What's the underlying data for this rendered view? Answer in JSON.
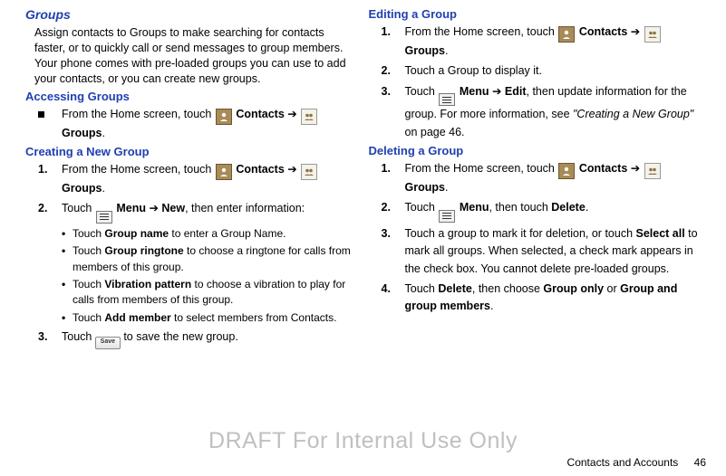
{
  "left": {
    "groups_heading": "Groups",
    "intro": "Assign contacts to Groups to make searching for contacts faster, or to quickly call or send messages to group members. Your phone comes with pre-loaded groups you can use to add your contacts, or you can create new groups.",
    "accessing_heading": "Accessing Groups",
    "accessing_pre": "From the Home screen, touch ",
    "contacts_label": "Contacts",
    "arrow": " ➔ ",
    "groups_label": "Groups",
    "period": ".",
    "creating_heading": "Creating a New Group",
    "c1_pre": "From the Home screen, touch ",
    "c2_pre": "Touch ",
    "c2_label_menu": "Menu",
    "c2_new": "New",
    "c2_post": ", then enter information:",
    "c2s1_pre": "Touch ",
    "c2s1_b": "Group name",
    "c2s1_post": " to enter a Group Name.",
    "c2s2_pre": "Touch ",
    "c2s2_b": "Group ringtone",
    "c2s2_post": " to choose a ringtone for calls from members of this group.",
    "c2s3_pre": "Touch ",
    "c2s3_b": "Vibration pattern",
    "c2s3_post": " to choose a vibration to play for calls from members of this group.",
    "c2s4_pre": "Touch ",
    "c2s4_b": "Add member",
    "c2s4_post": " to select members from Contacts.",
    "c3_pre": "Touch ",
    "c3_post": " to save the new group.",
    "save_label": "Save"
  },
  "right": {
    "editing_heading": "Editing a Group",
    "e1_pre": "From the Home screen, touch ",
    "e2": "Touch a Group to display it.",
    "e3_pre": "Touch ",
    "e3_menu": "Menu",
    "e3_edit": "Edit",
    "e3_post1": ", then update information for the group. For more information, see ",
    "e3_quote": "\"Creating a New Group\"",
    "e3_post2": " on page 46.",
    "deleting_heading": "Deleting a Group",
    "d1_pre": "From the Home screen, touch ",
    "d2_pre": "Touch ",
    "d2_menu": "Menu",
    "d2_post1": ", then touch ",
    "d2_delete": "Delete",
    "d3_pre": "Touch a group to mark it for deletion, or touch ",
    "d3_b": "Select all",
    "d3_post": " to mark all groups. When selected, a check mark appears in the check box. You cannot delete pre-loaded groups.",
    "d4_pre": "Touch ",
    "d4_b1": "Delete",
    "d4_mid": ", then choose ",
    "d4_b2": "Group only",
    "d4_or": " or ",
    "d4_b3": "Group and group members"
  },
  "watermark": "DRAFT For Internal Use Only",
  "footer": {
    "section": "Contacts and Accounts",
    "page": "46"
  },
  "markers": {
    "n1": "1.",
    "n2": "2.",
    "n3": "3.",
    "n4": "4."
  }
}
